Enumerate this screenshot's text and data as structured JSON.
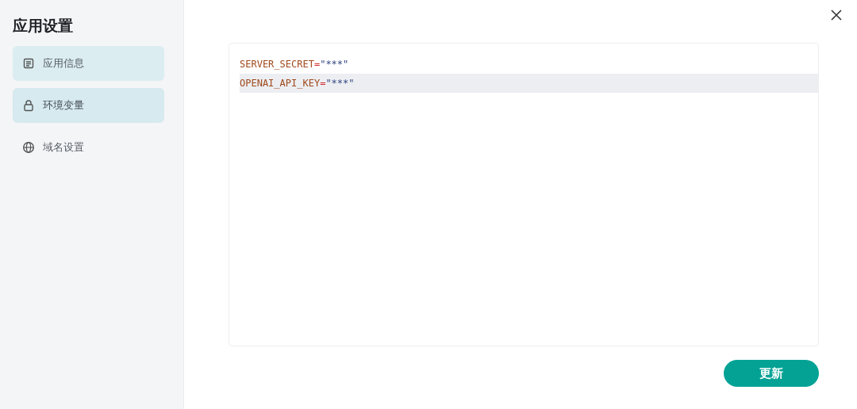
{
  "sidebar": {
    "title": "应用设置",
    "items": [
      {
        "label": "应用信息",
        "kind": "document",
        "selected": false,
        "hovered": true
      },
      {
        "label": "环境变量",
        "kind": "lock",
        "selected": true,
        "hovered": false
      },
      {
        "label": "域名设置",
        "kind": "globe",
        "selected": false,
        "hovered": false
      }
    ]
  },
  "editor": {
    "lines": [
      {
        "key": "SERVER_SECRET",
        "operator": "=",
        "value": "\"***\"",
        "active": false
      },
      {
        "key": "OPENAI_API_KEY",
        "operator": "=",
        "value": "\"***\"",
        "active": true
      }
    ]
  },
  "buttons": [
    {
      "label": "更新"
    }
  ]
}
